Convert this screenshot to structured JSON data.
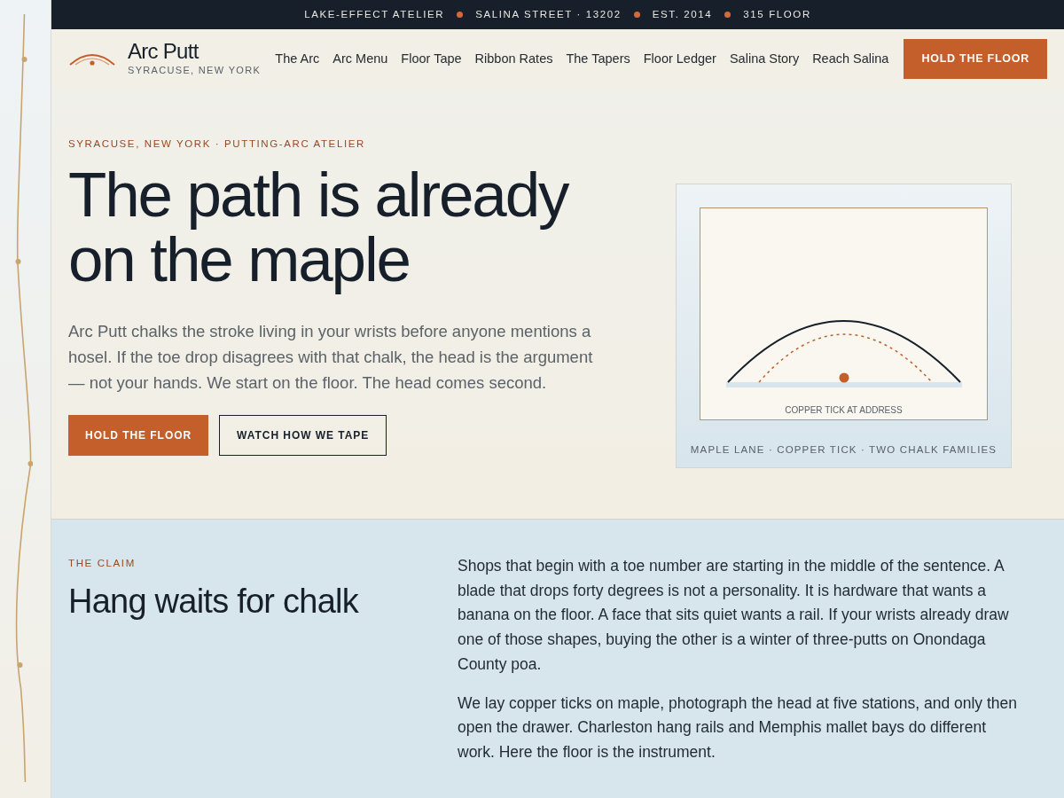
{
  "topbar": [
    "LAKE-EFFECT ATELIER",
    "SALINA STREET · 13202",
    "EST. 2014",
    "315 FLOOR"
  ],
  "brand": {
    "name": "Arc Putt",
    "place": "SYRACUSE, NEW YORK"
  },
  "nav": [
    "The Arc",
    "Arc Menu",
    "Floor Tape",
    "Ribbon Rates",
    "The Tapers",
    "Floor Ledger",
    "Salina Story",
    "Reach Salina"
  ],
  "nav_cta": "HOLD THE FLOOR",
  "hero": {
    "eyebrow": "SYRACUSE, NEW YORK · PUTTING-ARC ATELIER",
    "title": "The path is already on the maple",
    "body": "Arc Putt chalks the stroke living in your wrists before anyone mentions a hosel. If the toe drop disagrees with that chalk, the head is the argument — not your hands. We start on the floor. The head comes second.",
    "buttons": [
      {
        "label": "HOLD THE FLOOR",
        "kind": "primary"
      },
      {
        "label": "WATCH HOW WE TAPE",
        "kind": "outline"
      }
    ],
    "figure": {
      "inner_caption": "COPPER TICK AT ADDRESS",
      "caption": "MAPLE LANE · COPPER TICK · TWO CHALK FAMILIES"
    }
  },
  "claim": {
    "eyebrow": "THE CLAIM",
    "title": "Hang waits for chalk",
    "paragraphs": [
      "Shops that begin with a toe number are starting in the middle of the sentence. A blade that drops forty degrees is not a personality. It is hardware that wants a banana on the floor. A face that sits quiet wants a rail. If your wrists already draw one of those shapes, buying the other is a winter of three-putts on Onondaga County poa.",
      "We lay copper ticks on maple, photograph the head at five stations, and only then open the drawer. Charleston hang rails and Memphis mallet bays do different work. Here the floor is the instrument."
    ]
  }
}
